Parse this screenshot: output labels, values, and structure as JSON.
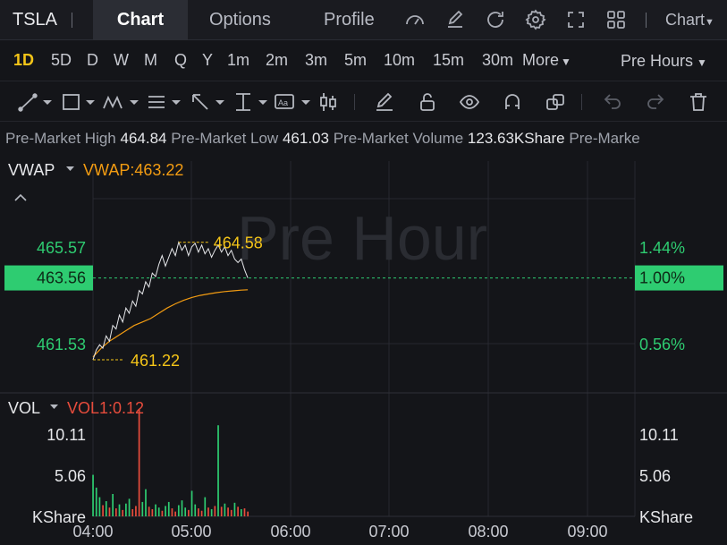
{
  "header": {
    "ticker": "TSLA",
    "tabs": [
      {
        "label": "Chart",
        "active": true
      },
      {
        "label": "Options",
        "active": false
      },
      {
        "label": "Profile",
        "active": false
      }
    ],
    "chart_type_label": "Chart"
  },
  "periods": {
    "items": [
      "1D",
      "5D",
      "D",
      "W",
      "M",
      "Q",
      "Y",
      "1m",
      "2m",
      "3m",
      "5m",
      "10m",
      "15m",
      "30m"
    ],
    "active": "1D",
    "more_label": "More",
    "session_label": "Pre Hours"
  },
  "info": {
    "high_label": "Pre-Market High",
    "high_value": "464.84",
    "low_label": "Pre-Market Low",
    "low_value": "461.03",
    "volume_label": "Pre-Market Volume",
    "volume_value": "123.63KShare",
    "trailing_label": "Pre-Marke"
  },
  "colors": {
    "up": "#2ecc71",
    "down": "#e74c3c",
    "vwap": "#f39c12",
    "highlight": "#f5c518",
    "price_tag_bg": "#2ecc71"
  },
  "chart_data": {
    "type": "line",
    "watermark": "Pre Hour",
    "indicator_label": "VWAP",
    "vwap_readout": "VWAP:463.22",
    "y_axis_left": [
      "465.57",
      "463.56",
      "461.53"
    ],
    "y_axis_right": [
      "1.44%",
      "1.00%",
      "0.56%"
    ],
    "current_price": "463.56",
    "current_pct": "1.00%",
    "high_marker": "464.58",
    "low_marker": "461.22",
    "ylim": [
      460.4,
      466.8
    ],
    "x_ticks": [
      "04:00",
      "05:00",
      "06:00",
      "07:00",
      "08:00",
      "09:00"
    ],
    "x_range_minutes": [
      0,
      330
    ],
    "series": [
      {
        "name": "price",
        "x": [
          0,
          2,
          4,
          6,
          8,
          10,
          12,
          14,
          16,
          18,
          20,
          22,
          24,
          26,
          28,
          30,
          32,
          34,
          36,
          38,
          40,
          42,
          44,
          46,
          48,
          50,
          52,
          54,
          56,
          58,
          60,
          62,
          64,
          66,
          68,
          70,
          72,
          74,
          76,
          78,
          80,
          82,
          84,
          86,
          88,
          90,
          92,
          94
        ],
        "values": [
          461.22,
          461.5,
          461.65,
          461.55,
          461.9,
          461.75,
          462.2,
          462.1,
          462.5,
          462.3,
          462.7,
          462.55,
          462.9,
          462.75,
          463.2,
          463.1,
          463.45,
          463.3,
          463.7,
          463.6,
          463.95,
          464.2,
          463.9,
          464.15,
          464.4,
          464.2,
          464.58,
          464.35,
          464.5,
          464.2,
          464.45,
          464.55,
          464.3,
          464.5,
          464.25,
          464.4,
          464.15,
          464.35,
          464.5,
          464.3,
          464.45,
          464.2,
          464.35,
          464.1,
          464.0,
          464.1,
          463.8,
          463.56
        ]
      },
      {
        "name": "VWAP",
        "x": [
          0,
          5,
          10,
          15,
          20,
          25,
          30,
          35,
          40,
          45,
          50,
          55,
          60,
          65,
          70,
          75,
          80,
          85,
          90,
          94
        ],
        "values": [
          461.3,
          461.55,
          461.75,
          461.9,
          462.05,
          462.2,
          462.3,
          462.4,
          462.55,
          462.7,
          462.82,
          462.92,
          463.0,
          463.06,
          463.1,
          463.14,
          463.17,
          463.19,
          463.21,
          463.22
        ]
      }
    ],
    "volume": {
      "indicator_label": "VOL",
      "readout": "VOL1:0.12",
      "y_axis": [
        "10.11",
        "5.06",
        "KShare"
      ],
      "ylim": [
        0,
        14
      ],
      "x": [
        0,
        2,
        4,
        6,
        8,
        10,
        12,
        14,
        16,
        18,
        20,
        22,
        24,
        26,
        28,
        30,
        32,
        34,
        36,
        38,
        40,
        42,
        44,
        46,
        48,
        50,
        52,
        54,
        56,
        58,
        60,
        62,
        64,
        66,
        68,
        70,
        72,
        74,
        76,
        78,
        80,
        82,
        84,
        86,
        88,
        90,
        92,
        94
      ],
      "values": [
        5.2,
        3.6,
        2.4,
        1.4,
        1.9,
        1.1,
        2.8,
        1.0,
        1.5,
        0.8,
        1.6,
        2.2,
        0.9,
        1.3,
        13.4,
        1.8,
        3.4,
        1.2,
        0.9,
        1.5,
        1.1,
        0.7,
        1.3,
        1.8,
        1.0,
        0.6,
        1.4,
        2.0,
        1.1,
        0.8,
        3.2,
        1.5,
        1.0,
        0.7,
        2.4,
        1.1,
        0.9,
        1.3,
        11.4,
        1.2,
        1.6,
        1.1,
        0.8,
        1.7,
        1.2,
        0.9,
        1.0,
        0.6
      ],
      "direction": [
        "up",
        "up",
        "up",
        "down",
        "up",
        "down",
        "up",
        "down",
        "up",
        "down",
        "up",
        "up",
        "down",
        "down",
        "down",
        "up",
        "up",
        "down",
        "down",
        "up",
        "up",
        "down",
        "up",
        "up",
        "down",
        "down",
        "up",
        "up",
        "up",
        "down",
        "up",
        "up",
        "down",
        "down",
        "up",
        "down",
        "up",
        "down",
        "up",
        "down",
        "up",
        "down",
        "down",
        "up",
        "down",
        "up",
        "down",
        "down"
      ]
    }
  }
}
